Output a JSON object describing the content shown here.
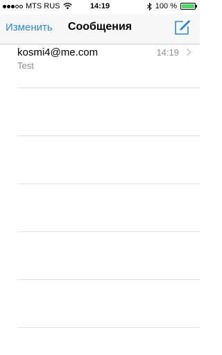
{
  "status_bar": {
    "signal_bars_filled": 3,
    "signal_bars_total": 5,
    "carrier": "MTS RUS",
    "wifi_icon": "wifi-icon",
    "time": "14:19",
    "bluetooth_icon": "bluetooth-icon",
    "battery_percent": "100 %",
    "battery_level": 1.0,
    "battery_color": "#4cd964"
  },
  "nav": {
    "edit_label": "Изменить",
    "title": "Сообщения",
    "compose_icon": "compose-icon",
    "accent_color": "#2a8ad4"
  },
  "messages": [
    {
      "sender": "kosmi4@me.com",
      "time": "14:19",
      "preview": "Test"
    }
  ]
}
